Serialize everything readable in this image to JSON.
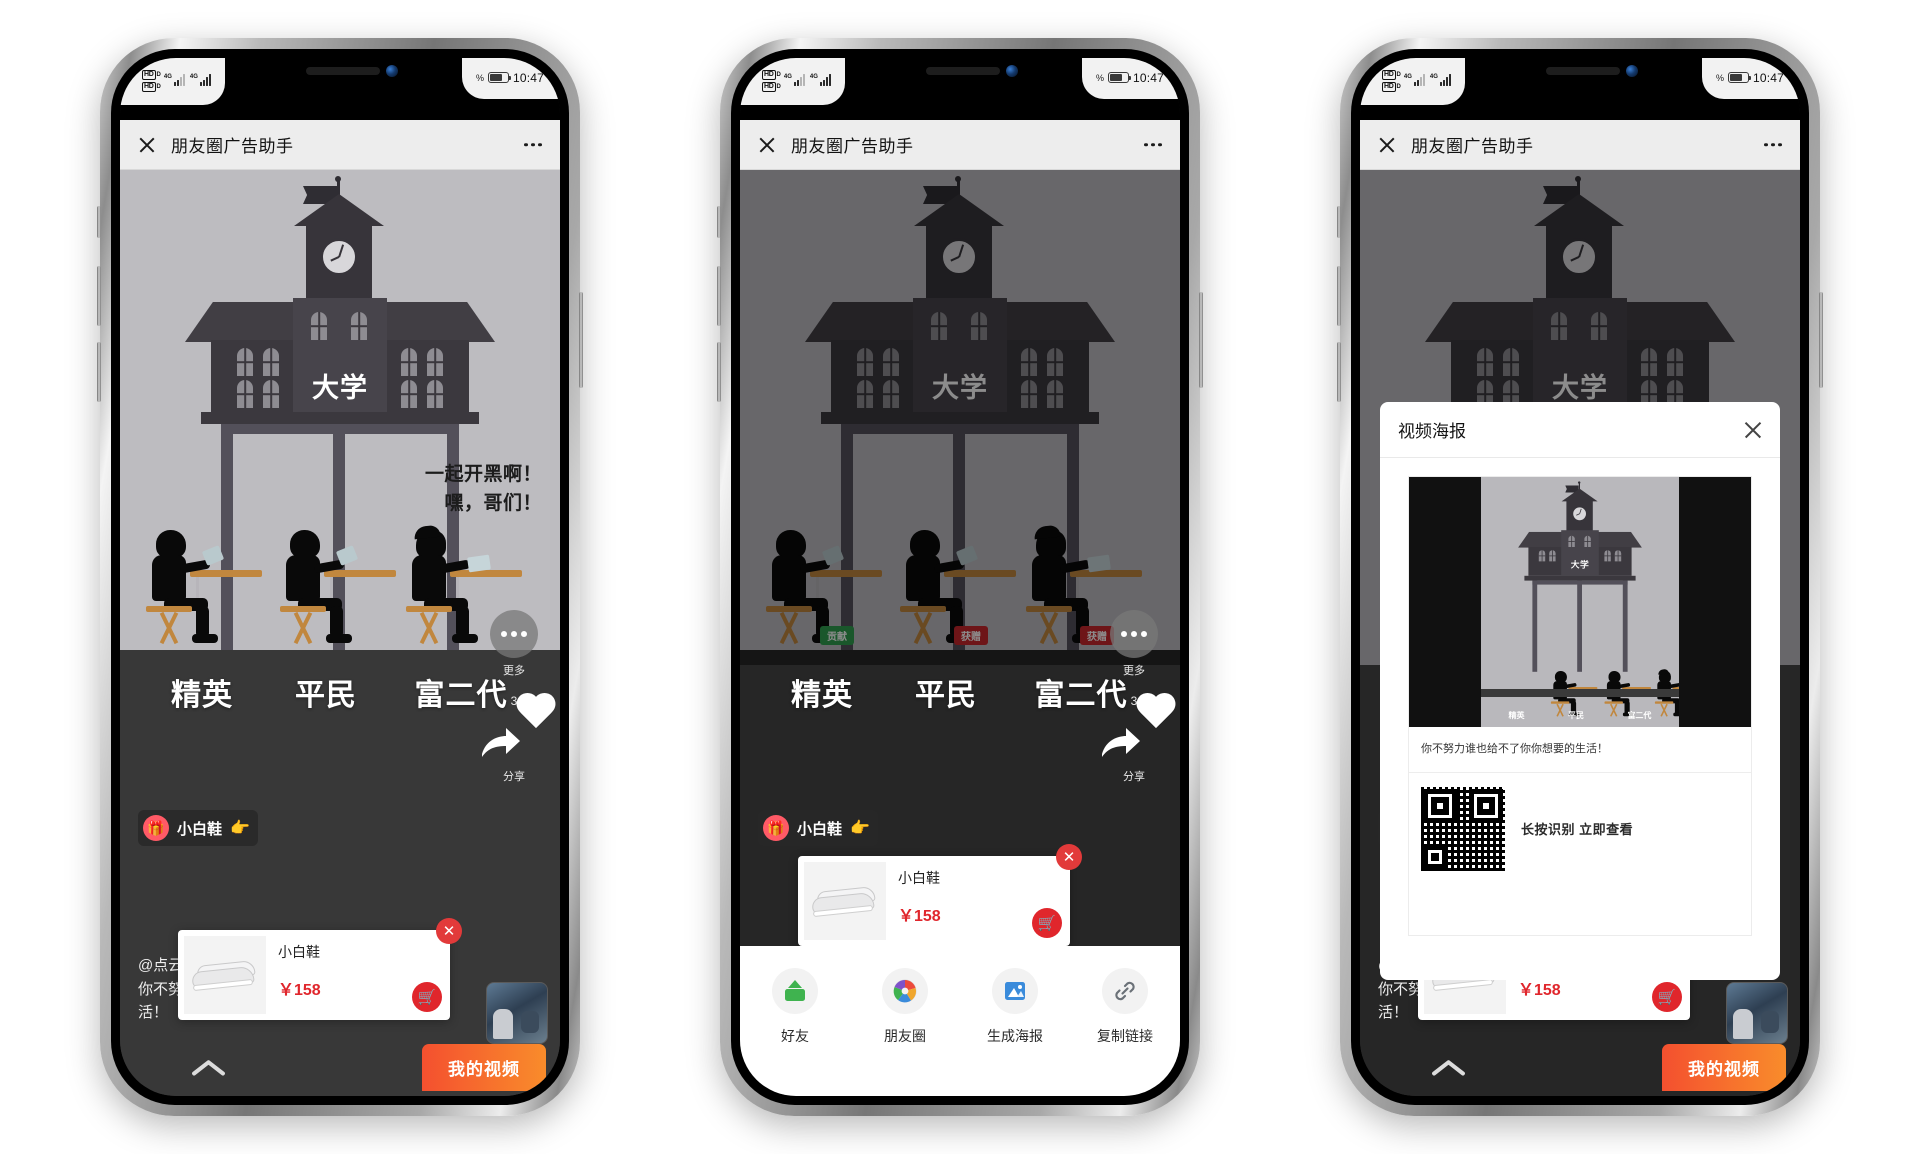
{
  "status_bar": {
    "hd_label": "HD",
    "network_label": "4G",
    "percent_symbol": "%",
    "time": "10:47"
  },
  "nav": {
    "title": "朋友圈广告助手",
    "close_icon": "close-icon",
    "more_icon": "more-dots-icon"
  },
  "video": {
    "building_label": "大学",
    "speech_line_1": "一起开黑啊！",
    "speech_line_2": "嘿，哥们！",
    "class_labels": [
      "精英",
      "平民",
      "富二代"
    ],
    "student_badges": [
      "贡献",
      "获赠",
      "获赠"
    ],
    "gift_tag": {
      "name": "小白鞋",
      "gift_icon": "gift-icon",
      "hand_icon": "pointing-hand-icon"
    },
    "rail": {
      "more_label": "更多",
      "like_count": "3",
      "share_label": "分享"
    },
    "caption_line_1": "@点云",
    "caption_line_2": "你不努",
    "caption_line_3": "活！",
    "bottom": {
      "chevron_icon": "chevron-up-icon",
      "my_video_label": "我的视频"
    }
  },
  "product_card": {
    "name": "小白鞋",
    "price": "￥158",
    "cart_icon": "cart-icon",
    "close_icon": "close-circle-icon"
  },
  "share_sheet": {
    "items": [
      {
        "label": "好友",
        "icon": "wechat-friend-icon",
        "color": "#3fb34f"
      },
      {
        "label": "朋友圈",
        "icon": "moments-icon",
        "color": "#ec4a3c"
      },
      {
        "label": "生成海报",
        "icon": "poster-image-icon",
        "color": "#3a8bdb"
      },
      {
        "label": "复制链接",
        "icon": "link-icon",
        "color": "#7a7f86"
      }
    ]
  },
  "poster_modal": {
    "title": "视频海报",
    "close_icon": "close-icon",
    "poster_labels": [
      "精英",
      "平民",
      "富二代"
    ],
    "poster_building_label": "大学",
    "caption": "你不努力谁也给不了你你想要的生活！",
    "qr_icon": "qr-code-icon",
    "qr_text": "长按识别 立即查看"
  },
  "colors": {
    "accent_orange": "#f4502f",
    "accent_red": "#e0262c",
    "nav_bg": "#ededed"
  }
}
